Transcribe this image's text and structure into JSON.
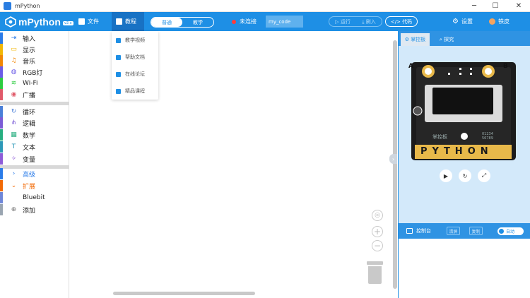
{
  "window": {
    "title": "mPython",
    "minimize": "─",
    "maximize": "☐",
    "close": "✕"
  },
  "brand": {
    "name": "mPython",
    "tag": "v2.x"
  },
  "menu": {
    "file": "文件",
    "tutorial": "教程"
  },
  "mode": {
    "normal": "普通",
    "teaching": "教学"
  },
  "connection": {
    "status": "未连接"
  },
  "file_name": "my_code",
  "actions": {
    "run": "运行",
    "flash": "刷入",
    "code": "代码"
  },
  "settings": "设置",
  "user": "铁皮",
  "tutorial_menu": [
    {
      "label": "教学视频",
      "icon": "video-icon"
    },
    {
      "label": "帮助文档",
      "icon": "help-doc-icon"
    },
    {
      "label": "在线论坛",
      "icon": "forum-icon"
    },
    {
      "label": "精品课程",
      "icon": "course-icon"
    }
  ],
  "categories": [
    {
      "label": "输入",
      "color": "#2b7ce9",
      "glyph": "⇥"
    },
    {
      "label": "显示",
      "color": "#f2b705",
      "glyph": "▭"
    },
    {
      "label": "音乐",
      "color": "#f28705",
      "glyph": "♫"
    },
    {
      "label": "RGB灯",
      "color": "#6c5ce7",
      "glyph": "◍"
    },
    {
      "label": "Wi-Fi",
      "color": "#2ecc40",
      "glyph": "≋"
    },
    {
      "label": "广播",
      "color": "#e05a6a",
      "glyph": "◉"
    },
    {
      "label": "循环",
      "color": "#4a7fd8",
      "glyph": "↻"
    },
    {
      "label": "逻辑",
      "color": "#7b5cd6",
      "glyph": "⋔"
    },
    {
      "label": "数学",
      "color": "#27ae80",
      "glyph": "▦"
    },
    {
      "label": "文本",
      "color": "#2d98b8",
      "glyph": "T"
    },
    {
      "label": "变量",
      "color": "#8e5cd8",
      "glyph": "✧"
    },
    {
      "label": "高级",
      "color": "#2b7ce9",
      "glyph": "›"
    },
    {
      "label": "扩展",
      "color": "#f26a05",
      "glyph": "⌄"
    },
    {
      "label": "Bluebit",
      "color": "#6f87d9",
      "glyph": ""
    },
    {
      "label": "添加",
      "color": "#9aa5b1",
      "glyph": "⊕"
    }
  ],
  "right_tabs": {
    "board": "掌控板",
    "explore": "探究"
  },
  "board": {
    "left_button": "A",
    "right_button": "B",
    "brand": "掌控板",
    "serial_top": "01234",
    "serial_bottom": "56789",
    "pins": "PYTHON"
  },
  "console": {
    "label": "控制台",
    "btn_left": "清屏",
    "btn_mid": "复制",
    "toggle": "自动"
  },
  "colors": {
    "primary": "#1e8fe5",
    "simulator_bg": "#d3e9fa"
  }
}
